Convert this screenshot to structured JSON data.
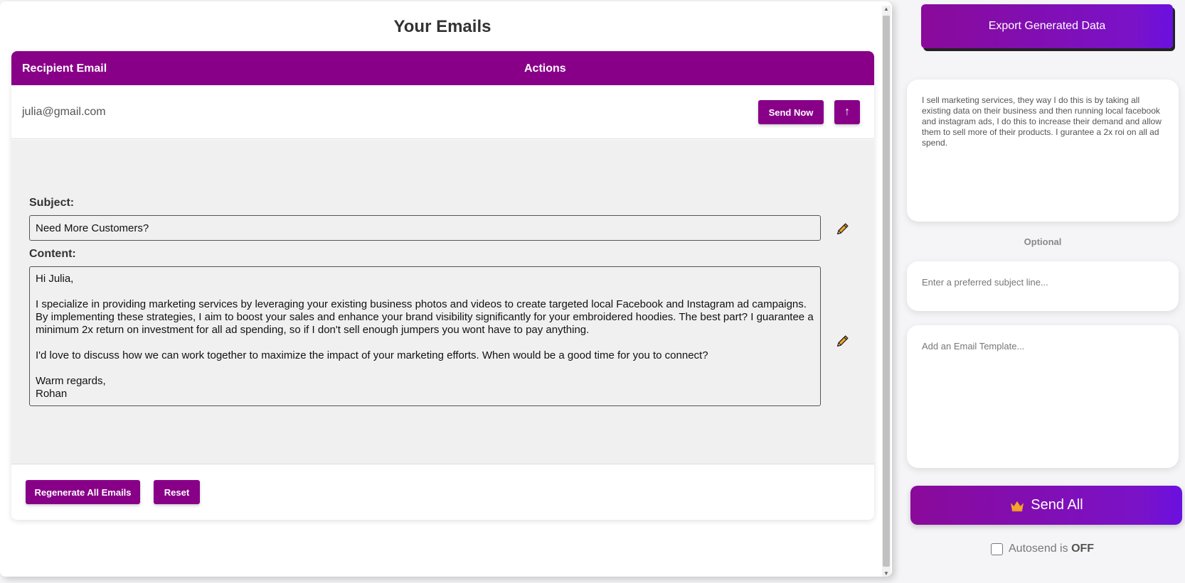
{
  "main": {
    "title": "Your Emails",
    "table": {
      "headers": {
        "email": "Recipient Email",
        "actions": "Actions"
      },
      "row": {
        "email": "julia@gmail.com",
        "send_now_label": "Send Now",
        "up_label": "↑"
      }
    },
    "details": {
      "subject_label": "Subject:",
      "subject_value": "Need More Customers?",
      "content_label": "Content:",
      "content_value": "Hi Julia,\n\nI specialize in providing marketing services by leveraging your existing business photos and videos to create targeted local Facebook and Instagram ad campaigns. By implementing these strategies, I aim to boost your sales and enhance your brand visibility significantly for your embroidered hoodies. The best part? I guarantee a minimum 2x return on investment for all ad spending, so if I don't sell enough jumpers you wont have to pay anything.\n\nI'd love to discuss how we can work together to maximize the impact of your marketing efforts. When would be a good time for you to connect?\n\nWarm regards,\nRohan"
    },
    "footer": {
      "regenerate_label": "Regenerate All Emails",
      "reset_label": "Reset"
    }
  },
  "sidebar": {
    "export_label": "Export Generated Data",
    "description_value": "I sell marketing services, they way I do this is by taking all existing data on their business and then running local facebook and instagram ads, I do this to increase their demand and allow them to sell more of their products. I gurantee a 2x roi on all ad spend.",
    "optional_label": "Optional",
    "subject_placeholder": "Enter a preferred subject line...",
    "template_placeholder": "Add an Email Template...",
    "send_all_label": "Send All",
    "autosend_label": "Autosend is",
    "autosend_state": "OFF"
  },
  "colors": {
    "primary": "#880088",
    "gradient_end": "#6a10e0",
    "crown": "#f5a623"
  },
  "icons": {
    "edit": "pencil-icon",
    "crown": "crown-icon"
  }
}
